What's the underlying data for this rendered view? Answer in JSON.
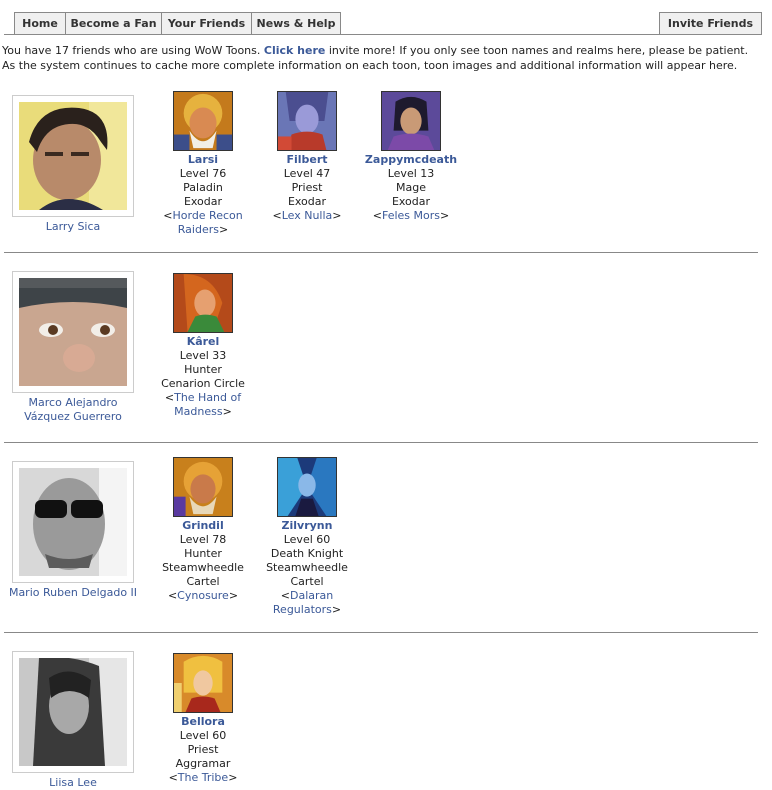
{
  "tabs": {
    "home": "Home",
    "fan": "Become a Fan",
    "friends": "Your Friends",
    "news": "News & Help",
    "invite": "Invite Friends"
  },
  "intro": {
    "before": "You have 17 friends who are using WoW Toons.",
    "link": "Click here",
    "after": "invite more! If you only see toon names and realms here, please be patient. As the system continues to cache more complete information on each toon, toon images and additional information will appear here."
  },
  "friends": [
    {
      "name": "Larry Sica",
      "toons": [
        {
          "name": "Larsi",
          "level": "Level 76",
          "class": "Paladin",
          "realm": "Exodar",
          "guild": "Horde Recon Raiders"
        },
        {
          "name": "Filbert",
          "level": "Level 47",
          "class": "Priest",
          "realm": "Exodar",
          "guild": "Lex Nulla"
        },
        {
          "name": "Zappymcdeath",
          "level": "Level 13",
          "class": "Mage",
          "realm": "Exodar",
          "guild": "Feles Mors"
        }
      ]
    },
    {
      "name": "Marco Alejandro Vázquez Guerrero",
      "toons": [
        {
          "name": "Kârel",
          "level": "Level 33",
          "class": "Hunter",
          "realm": "Cenarion Circle",
          "guild": "The Hand of Madness"
        }
      ]
    },
    {
      "name": "Mario Ruben Delgado II",
      "toons": [
        {
          "name": "Grindil",
          "level": "Level 78",
          "class": "Hunter",
          "realm": "Steamwheedle Cartel",
          "guild": "Cynosure"
        },
        {
          "name": "Zilvrynn",
          "level": "Level 60",
          "class": "Death Knight",
          "realm": "Steamwheedle Cartel",
          "guild": "Dalaran Regulators"
        }
      ]
    },
    {
      "name": "Liisa Lee",
      "toons": [
        {
          "name": "Bellora",
          "level": "Level 60",
          "class": "Priest",
          "realm": "Aggramar",
          "guild": "The Tribe"
        }
      ]
    }
  ],
  "colors": {
    "link": "#3b5998",
    "tab_bg": "#f0f0f0",
    "separator": "#888888"
  }
}
